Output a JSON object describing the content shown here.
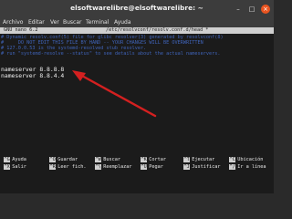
{
  "window": {
    "title": "elsoftwarelibre@elsoftwarelibre: ~",
    "controls": {
      "minimize": "–",
      "maximize": "□",
      "close": "×"
    }
  },
  "menu": [
    "Archivo",
    "Editar",
    "Ver",
    "Buscar",
    "Terminal",
    "Ayuda"
  ],
  "nano": {
    "version": "GNU nano 6.2",
    "file": "/etc/resolvconf/resolv.conf.d/head *"
  },
  "comments": [
    "# Dynamic resolv.conf(5) file for glibc resolver(3) generated by resolvconf(8)",
    "#     DO NOT EDIT THIS FILE BY HAND -- YOUR CHANGES WILL BE OVERWRITTEN",
    "# 127.0.0.53 is the systemd-resolved stub resolver.",
    "# run \"systemd-resolve --status\" to see details about the actual nameservers."
  ],
  "lines": [
    "nameserver 8.8.8.8",
    "nameserver 8.8.4.4"
  ],
  "shortcuts": [
    [
      {
        "key": "^G",
        "label": "Ayuda"
      },
      {
        "key": "^O",
        "label": "Guardar"
      },
      {
        "key": "^W",
        "label": "Buscar"
      },
      {
        "key": "^K",
        "label": "Cortar"
      },
      {
        "key": "^T",
        "label": "Ejecutar"
      },
      {
        "key": "^C",
        "label": "Ubicación"
      }
    ],
    [
      {
        "key": "^X",
        "label": "Salir"
      },
      {
        "key": "^R",
        "label": "Leer fich."
      },
      {
        "key": "^\\",
        "label": "Reemplazar"
      },
      {
        "key": "^U",
        "label": "Pegar"
      },
      {
        "key": "^J",
        "label": "Justificar"
      },
      {
        "key": "^/",
        "label": "Ir a línea"
      }
    ]
  ],
  "colors": {
    "terminal_bg": "#1b1b1b",
    "comment": "#3f63b8",
    "arrow": "#d42020",
    "window_close": "#e95420"
  }
}
